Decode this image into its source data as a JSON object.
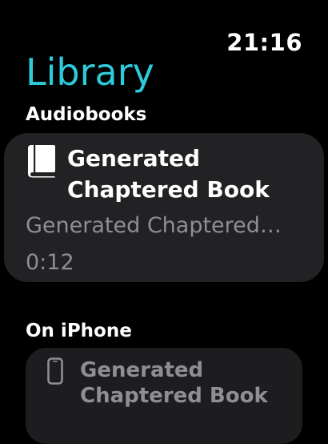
{
  "status": {
    "time": "21:16"
  },
  "header": {
    "title": "Library"
  },
  "sections": {
    "audiobooks": {
      "label": "Audiobooks",
      "items": [
        {
          "title": "Generated Chaptered Book",
          "subtitle": "Generated Chaptered…",
          "duration": "0:12",
          "icon": "book-icon"
        }
      ]
    },
    "on_iphone": {
      "label": "On iPhone",
      "items": [
        {
          "title": "Generated Chaptered Book",
          "icon": "iphone-icon"
        }
      ]
    }
  },
  "colors": {
    "accent": "#2ecad9",
    "background": "#000000",
    "card": "#222224",
    "secondary_text": "#8e8e93"
  }
}
